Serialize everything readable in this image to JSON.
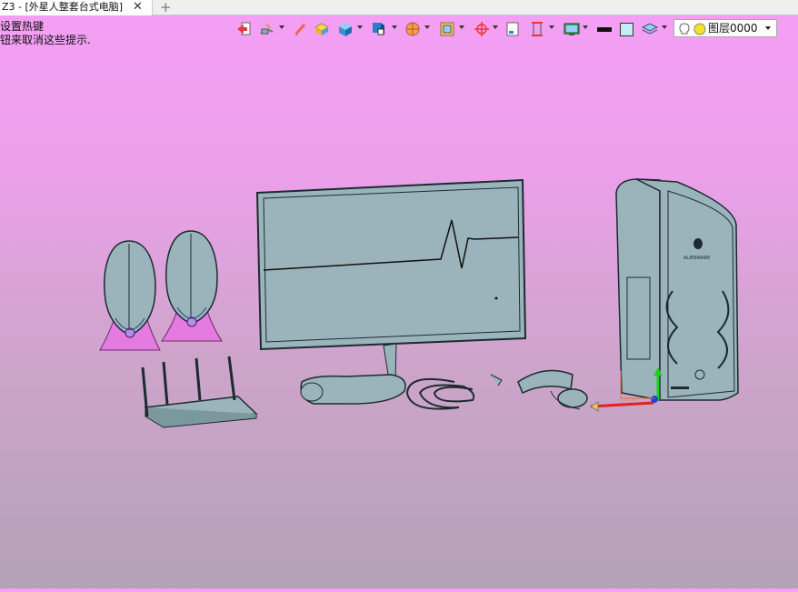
{
  "tab": {
    "title": "Z3 - [外星人整套台式电脑]",
    "close_glyph": "✕",
    "add_glyph": "+"
  },
  "hint": {
    "line1": "设置热键",
    "line2": "钮来取消这些提示."
  },
  "layer": {
    "label": "图层0000"
  },
  "colors": {
    "model": "#9bb4bb",
    "edge": "#1b2b30",
    "accent_pink": "#e57be0",
    "axis_x": "#e22020",
    "axis_y": "#22cc22",
    "axis_z": "#2244dd"
  },
  "icons": [
    "exit-icon",
    "brush-icon",
    "pencil-icon",
    "box-yellow-icon",
    "cube-icon",
    "shaded-cube-icon",
    "sphere-icon",
    "frame-icon",
    "target-icon",
    "page-icon",
    "ruler-icon",
    "display-icon",
    "color-swatch",
    "color-swatch-light",
    "layer-icon",
    "bulb-icon",
    "layer-status-dot"
  ],
  "case_badge": "ALIENWARE"
}
